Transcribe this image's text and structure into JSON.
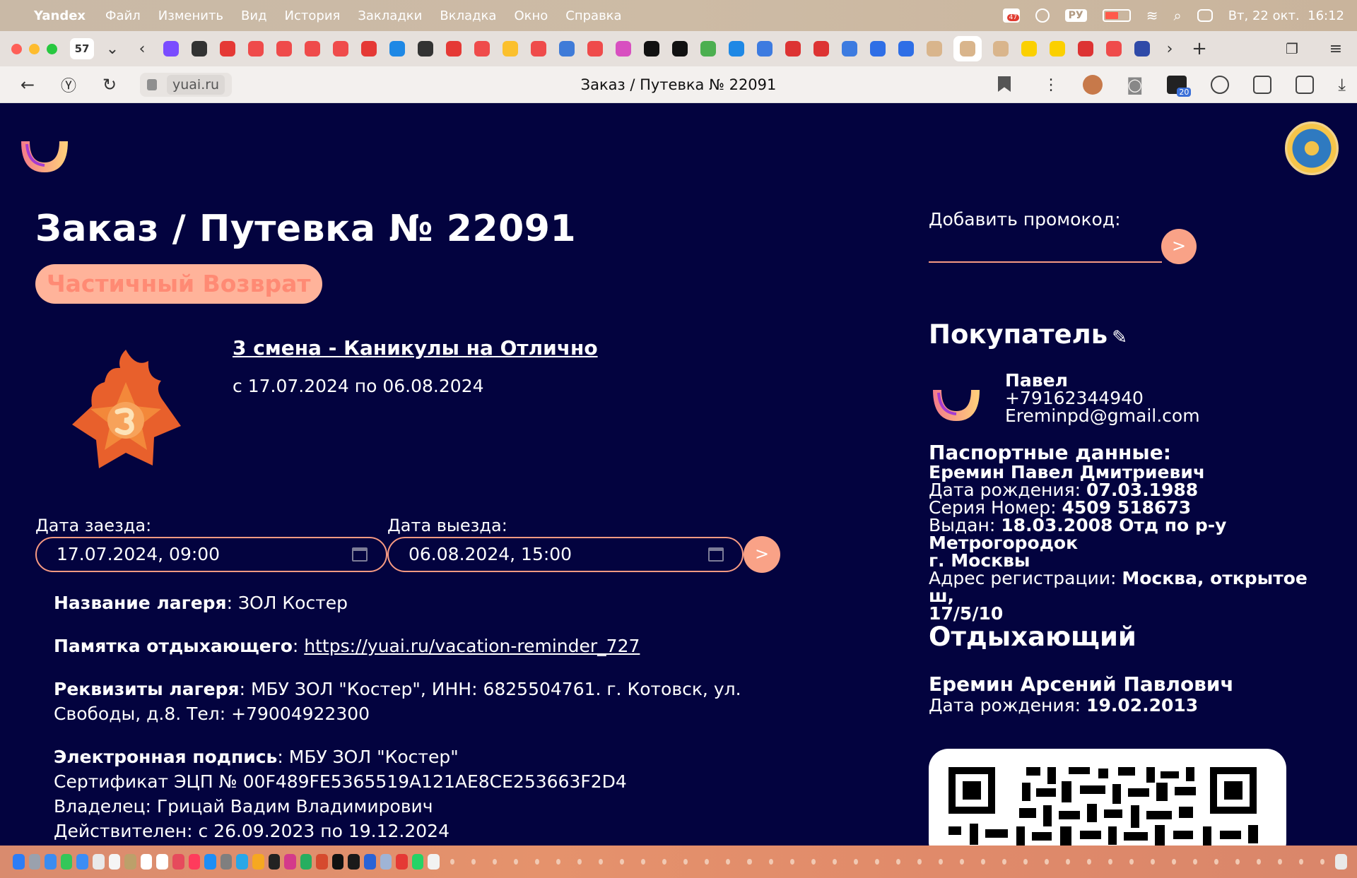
{
  "menubar": {
    "app_name": "Yandex",
    "items": [
      "Файл",
      "Изменить",
      "Вид",
      "История",
      "Закладки",
      "Вкладка",
      "Окно",
      "Справка"
    ],
    "lang": "РУ",
    "datetime": "Вт, 22 окт.  16:12",
    "badge": "47"
  },
  "tabstrip": {
    "tab_count": "57",
    "favicons": [
      "alisa",
      "qr",
      "Y",
      "Я",
      "Я",
      "Я",
      "Я",
      "Y",
      "wave",
      "puzzle",
      "Y",
      "Я",
      "play",
      "Я",
      "G",
      "Я",
      "B",
      "star",
      "star",
      "grid",
      "@",
      "mail",
      "ru-flag",
      "ru-flag",
      "mail",
      "doc",
      "doc",
      "smile",
      "smile",
      "smile",
      "T",
      "T",
      "ru-flag",
      "Я",
      "H"
    ]
  },
  "addressbar": {
    "domain": "yuai.ru",
    "page_title": "Заказ / Путевка № 22091",
    "ext_badge": "20"
  },
  "order": {
    "title": "Заказ / Путевка № 22091",
    "status": "Частичный Возврат",
    "shift_link": "3 смена - Каникулы на Отлично",
    "shift_dates": "с 17.07.2024 по 06.08.2024",
    "checkin_label": "Дата заезда:",
    "checkin_value": "17.07.2024, 09:00",
    "checkout_label": "Дата выезда:",
    "checkout_value": "06.08.2024, 15:00",
    "submit_label": ">"
  },
  "camp": {
    "name_label": "Название лагеря",
    "name_value": ": ЗОЛ Костер",
    "reminder_label": "Памятка отдыхающего",
    "reminder_sep": ": ",
    "reminder_link": "https://yuai.ru/vacation-reminder_727",
    "requisites_label": "Реквизиты лагеря",
    "requisites_value": ": МБУ ЗОЛ \"Костер\", ИНН: 6825504761. г. Котовск, ул.",
    "requisites_value2": "Свободы, д.8. Тел: +79004922300",
    "esign_label": "Электронная подпись",
    "esign_value": ": МБУ ЗОЛ \"Костер\"",
    "cert": "Сертификат ЭЦП № 00F489FE5365519A121AE8CE253663F2D4",
    "owner": "Владелец: Грицай Вадим Владимирович",
    "valid": "Действителен: с 26.09.2023 по 19.12.2024"
  },
  "promo": {
    "label": "Добавить промокод:",
    "value": "",
    "submit_label": ">"
  },
  "buyer": {
    "section_title": "Покупатель",
    "edit_icon": "✎",
    "name": "Павел",
    "phone": "+79162344940",
    "email": "Ereminpd@gmail.com",
    "passport_header": "Паспортные данные:",
    "full_name": "Еремин Павел Дмитриевич",
    "dob_label": "Дата рождения: ",
    "dob_value": "07.03.1988",
    "series_label": "Серия Номер: ",
    "series_value": "4509 518673",
    "issued_label": "Выдан: ",
    "issued_value": "18.03.2008 Отд по р-у Метрогородок",
    "issued_value2": "г. Москвы",
    "address_label": "Адрес регистрации: ",
    "address_value": "Москва, открытое ш,",
    "address_value2": "17/5/10"
  },
  "vacationer": {
    "section_title": "Отдыхающий",
    "name": "Еремин Арсений Павлович",
    "dob_label": "Дата рождения: ",
    "dob_value": "19.02.2013"
  },
  "colors": {
    "page_bg": "#03033f",
    "accent": "#f9a287",
    "status_bg": "#ffb39a",
    "status_text": "#ff8a74"
  }
}
